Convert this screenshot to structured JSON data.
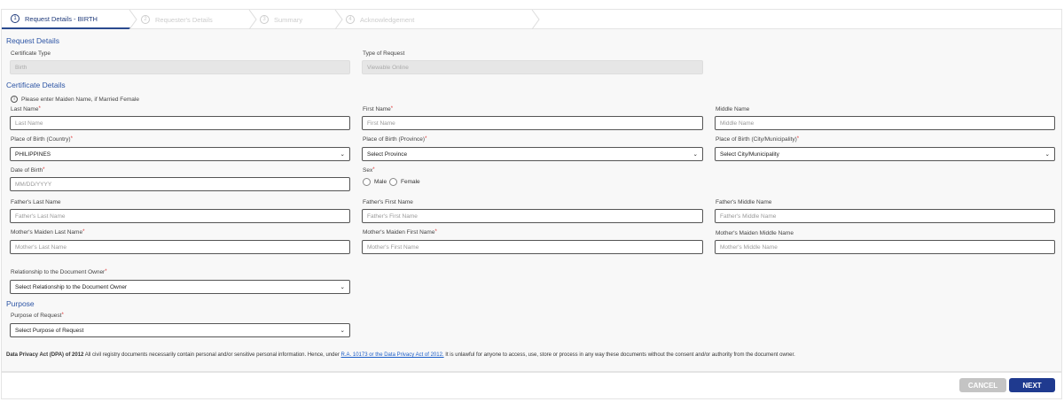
{
  "steps": [
    {
      "num": "1",
      "label": "Request Details - BIRTH"
    },
    {
      "num": "2",
      "label": "Requester's Details"
    },
    {
      "num": "3",
      "label": "Summary"
    },
    {
      "num": "4",
      "label": "Acknowledgement"
    }
  ],
  "request_details": {
    "heading": "Request Details",
    "certificate_type_label": "Certificate Type",
    "certificate_type_value": "Birth",
    "type_of_request_label": "Type of Request",
    "type_of_request_value": "Viewable Online"
  },
  "certificate_details": {
    "heading": "Certificate Details",
    "info_icon": "i",
    "note": "Please enter Maiden Name, if Married Female",
    "last_name": {
      "label": "Last Name",
      "placeholder": "Last Name"
    },
    "first_name": {
      "label": "First Name",
      "placeholder": "First Name"
    },
    "middle_name": {
      "label": "Middle Name",
      "placeholder": "Middle Name"
    },
    "pob_country": {
      "label": "Place of Birth (Country)",
      "value": "PHILIPPINES"
    },
    "pob_province": {
      "label": "Place of Birth (Province)",
      "value": "Select Province"
    },
    "pob_city": {
      "label": "Place of Birth (City/Municipality)",
      "value": "Select City/Municipality"
    },
    "dob": {
      "label": "Date of Birth",
      "placeholder": "MM/DD/YYYY"
    },
    "sex": {
      "label": "Sex",
      "options": [
        "Male",
        "Female"
      ]
    },
    "father_last": {
      "label": "Father's Last Name",
      "placeholder": "Father's Last Name"
    },
    "father_first": {
      "label": "Father's First Name",
      "placeholder": "Father's First Name"
    },
    "father_middle": {
      "label": "Father's Middle Name",
      "placeholder": "Father's Middle Name"
    },
    "mother_last": {
      "label": "Mother's Maiden Last Name",
      "placeholder": "Mother's Last Name"
    },
    "mother_first": {
      "label": "Mother's Maiden First Name",
      "placeholder": "Mother's First Name"
    },
    "mother_middle": {
      "label": "Mother's Maiden Middle Name",
      "placeholder": "Mother's Middle Name"
    },
    "relationship": {
      "label": "Relationship to the Document Owner",
      "value": "Select Relationship to the Document Owner"
    }
  },
  "purpose": {
    "heading": "Purpose",
    "label": "Purpose of Request",
    "value": "Select Purpose of Request"
  },
  "privacy": {
    "title": "Data Privacy Act (DPA) of 2012",
    "text1": " All civil registry documents necessarily contain personal and/or sensitive personal information. Hence, under ",
    "link": "R.A. 10173 or the Data Privacy Act of 2012.",
    "text2": " It is unlawful for anyone to access, use, store or process in any way these documents without the consent and/or authority from the document owner."
  },
  "required_mark": "*",
  "buttons": {
    "cancel": "CANCEL",
    "next": "NEXT"
  },
  "colors": {
    "accent": "#1f3a8f",
    "heading": "#2d55a5",
    "cancel": "#c4c4c4"
  }
}
